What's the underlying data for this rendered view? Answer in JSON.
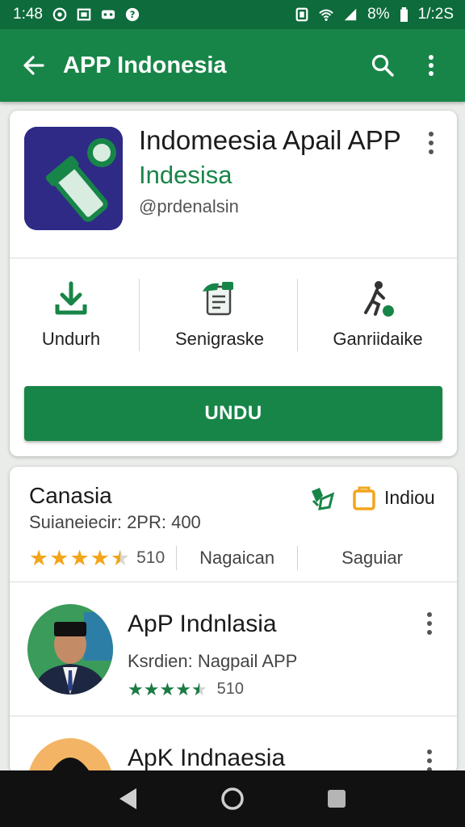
{
  "status_bar": {
    "time": "1:48",
    "battery": "8%",
    "clock_right": "1/:2S",
    "icons": [
      "sync-icon",
      "cast-icon",
      "voicemail-icon",
      "help-icon",
      "vibrate-icon",
      "wifi-icon",
      "signal-icon",
      "battery-icon"
    ]
  },
  "toolbar": {
    "title": "APP Indonesia",
    "icons": [
      "back-arrow-icon",
      "search-icon",
      "more-vert-icon"
    ],
    "background": "#188548"
  },
  "app": {
    "name": "Indomeesia Apail APP",
    "developer": "Indesisa",
    "handle": "@prdenalsin",
    "icon": "microphone-logo-icon",
    "accent": "#188548"
  },
  "actions": [
    {
      "label": "Undurh",
      "icon": "download-icon"
    },
    {
      "label": "Senigraske",
      "icon": "share-icon"
    },
    {
      "label": "Ganriidaike",
      "icon": "activity-icon"
    }
  ],
  "primary_button": {
    "label": "UNDU"
  },
  "section": {
    "title": "Canasia",
    "subtitle": "Suianeiecir: 2PR: 400",
    "chips": [
      {
        "label": "",
        "icon": "leaf-icon"
      },
      {
        "label": "Indiou",
        "icon": "bag-icon"
      }
    ],
    "rating": {
      "value": 4.5,
      "display": "510"
    },
    "columns": [
      "Nagaican",
      "Saguiar"
    ],
    "star_color": "#f2a51b"
  },
  "list": [
    {
      "title": "ApP Indnlasia",
      "subtitle": "Ksrdien: Nagpail APP",
      "rating": {
        "value": 4.5,
        "display": "510"
      },
      "icon": "person-avatar-icon"
    },
    {
      "title": "ApK Indnaesia",
      "subtitle": "",
      "icon": "person-avatar-icon"
    }
  ],
  "nav_bar": {
    "icons": [
      "back-triangle-icon",
      "home-circle-icon",
      "recents-square-icon"
    ]
  }
}
